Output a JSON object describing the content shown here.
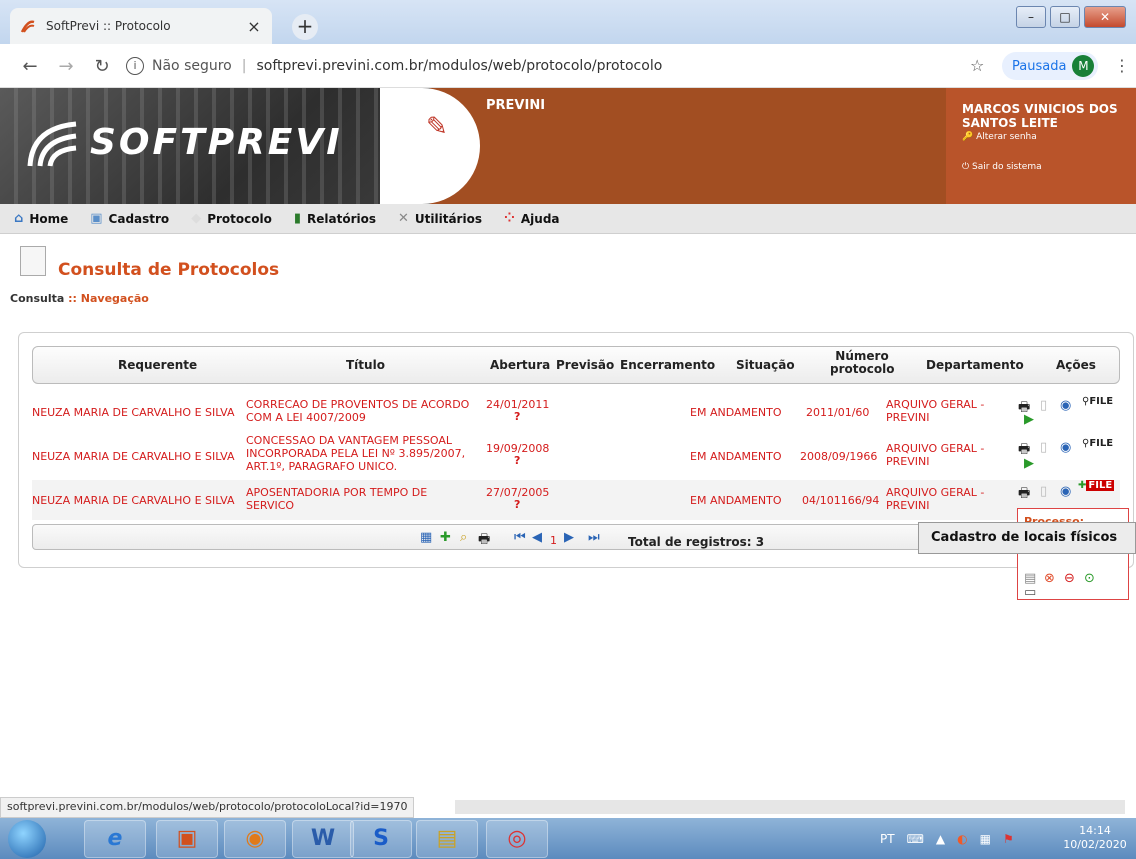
{
  "browser": {
    "tab_title": "SoftPrevi :: Protocolo",
    "tab_close": "×",
    "new_tab": "+",
    "not_secure": "Não seguro",
    "url": "softprevi.previni.com.br/modulos/web/protocolo/protocolo",
    "profile_state": "Pausada",
    "profile_initial": "M",
    "status_url": "softprevi.previni.com.br/modulos/web/protocolo/protocoloLocal?id=1970"
  },
  "header": {
    "logo": "SOFTPREVI",
    "org": "PREVINI",
    "user_name": "MARCOS VINICIOS DOS SANTOS LEITE",
    "change_password": "Alterar senha",
    "logout": "Sair do sistema"
  },
  "menu": [
    {
      "label": "Home",
      "icon": "home-icon"
    },
    {
      "label": "Cadastro",
      "icon": "cadastro-icon"
    },
    {
      "label": "Protocolo",
      "icon": "protocolo-icon"
    },
    {
      "label": "Relatórios",
      "icon": "chart-icon"
    },
    {
      "label": "Utilitários",
      "icon": "tools-icon"
    },
    {
      "label": "Ajuda",
      "icon": "help-icon"
    }
  ],
  "page": {
    "title": "Consulta de Protocolos",
    "crumb_a": "Consulta",
    "crumb_sep": " :: ",
    "crumb_b": "Navegação"
  },
  "table": {
    "headers": {
      "requerente": "Requerente",
      "titulo": "Título",
      "abertura": "Abertura",
      "previsao": "Previsão",
      "encerramento": "Encerramento",
      "situacao": "Situação",
      "numero_1": "Número",
      "numero_2": "protocolo",
      "departamento": "Departamento",
      "acoes": "Ações"
    },
    "rows": [
      {
        "requerente": "NEUZA MARIA DE CARVALHO E SILVA",
        "titulo": "CORRECAO DE PROVENTOS DE ACORDO COM A LEI 4007/2009",
        "abertura": "24/01/2011",
        "flag": "?",
        "situacao": "EM ANDAMENTO",
        "numero": "2011/01/60",
        "departamento": "ARQUIVO GERAL - PREVINI"
      },
      {
        "requerente": "NEUZA MARIA DE CARVALHO E SILVA",
        "titulo": "CONCESSAO DA VANTAGEM PESSOAL INCORPORADA PELA LEI Nº 3.895/2007, ART.1º, PARAGRAFO UNICO.",
        "abertura": "19/09/2008",
        "flag": "?",
        "situacao": "EM ANDAMENTO",
        "numero": "2008/09/1966",
        "departamento": "ARQUIVO GERAL - PREVINI"
      },
      {
        "requerente": "NEUZA MARIA DE CARVALHO E SILVA",
        "titulo": "APOSENTADORIA POR TEMPO DE SERVICO",
        "abertura": "27/07/2005",
        "flag": "?",
        "situacao": "EM ANDAMENTO",
        "numero": "04/101166/94",
        "departamento": "ARQUIVO GERAL - PREVINI"
      }
    ],
    "page_current": "1",
    "total_label": "Total de registros: 3"
  },
  "popup": {
    "header": "Processo:",
    "tooltip": "Cadastro de locais físicos"
  },
  "taskbar": {
    "lang": "PT",
    "time": "14:14",
    "date": "10/02/2020"
  },
  "colors": {
    "accent": "#d2501e",
    "header_bg": "#a24e22",
    "link_red": "#d41c1c"
  }
}
